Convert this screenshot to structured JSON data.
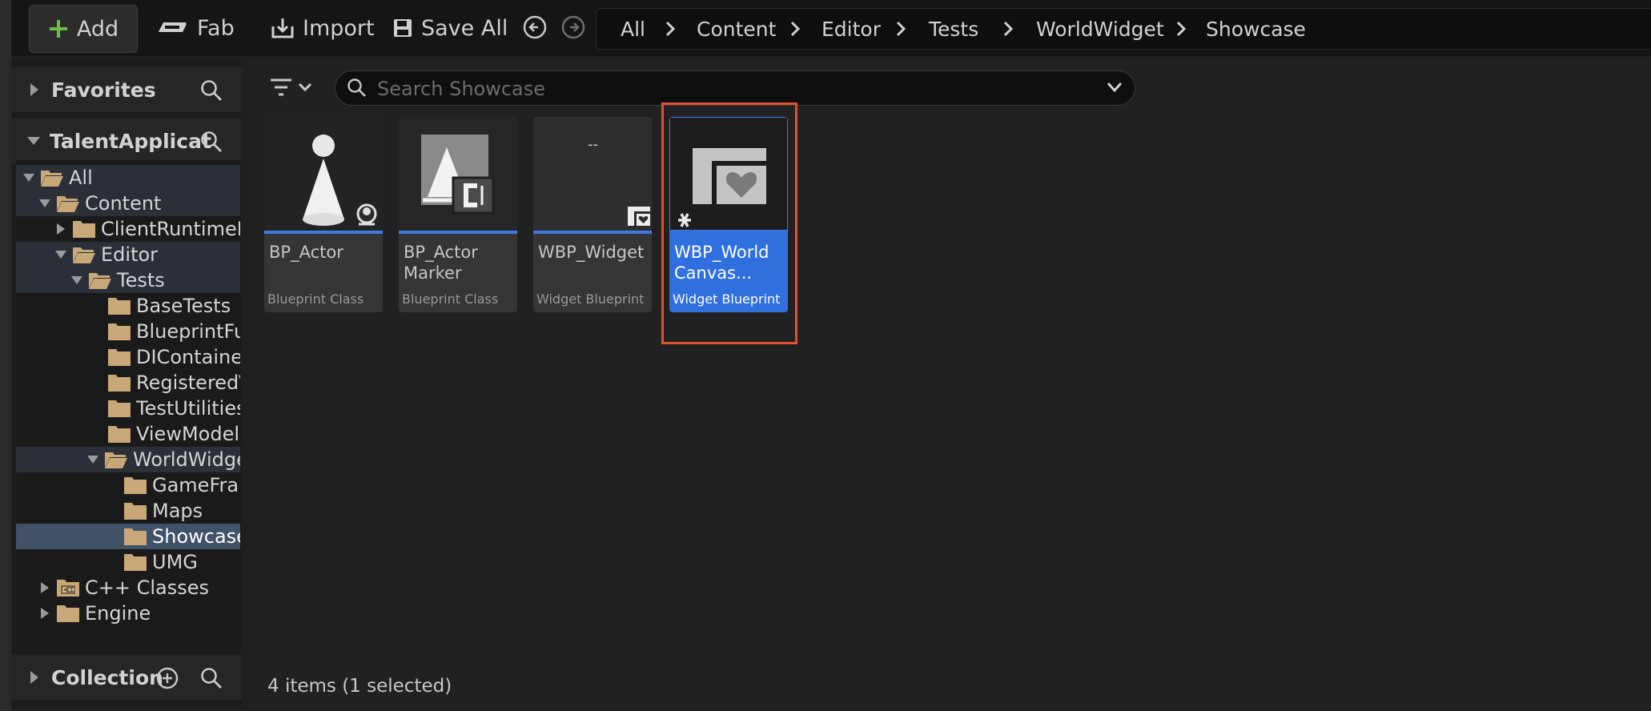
{
  "toolbar": {
    "add_label": "Add",
    "fab_label": "Fab",
    "import_label": "Import",
    "save_all_label": "Save All"
  },
  "breadcrumb": [
    "All",
    "Content",
    "Editor",
    "Tests",
    "WorldWidget",
    "Showcase"
  ],
  "left_panel": {
    "favorites_label": "Favorites",
    "project_label": "TalentApplicat",
    "collection_label": "Collection",
    "tree": [
      {
        "label": "All"
      },
      {
        "label": "Content"
      },
      {
        "label": "ClientRuntimeM"
      },
      {
        "label": "Editor"
      },
      {
        "label": "Tests"
      },
      {
        "label": "BaseTests"
      },
      {
        "label": "BlueprintFu"
      },
      {
        "label": "DIContaine"
      },
      {
        "label": "Registered\\"
      },
      {
        "label": "TestUtilities"
      },
      {
        "label": "ViewModel"
      },
      {
        "label": "WorldWidge"
      },
      {
        "label": "GameFra"
      },
      {
        "label": "Maps"
      },
      {
        "label": "Showcase"
      },
      {
        "label": "UMG"
      },
      {
        "label": "C++ Classes"
      },
      {
        "label": "Engine"
      }
    ]
  },
  "search": {
    "placeholder": "Search Showcase"
  },
  "assets": [
    {
      "name": "BP_Actor",
      "type": "Blueprint Class"
    },
    {
      "name": "BP_Actor Marker",
      "type": "Blueprint Class"
    },
    {
      "name": "WBP_Widget",
      "type": "Widget Blueprint",
      "thumb_text": "--"
    },
    {
      "name": "WBP_World Canvas...",
      "type": "Widget Blueprint"
    }
  ],
  "status": "4 items (1 selected)",
  "colors": {
    "selection_blue": "#2f6fde",
    "highlight_outline": "#e2512f",
    "blueprint_bar": "#3f7be0",
    "folder": "#c8a878",
    "add_plus": "#6abf4b"
  }
}
